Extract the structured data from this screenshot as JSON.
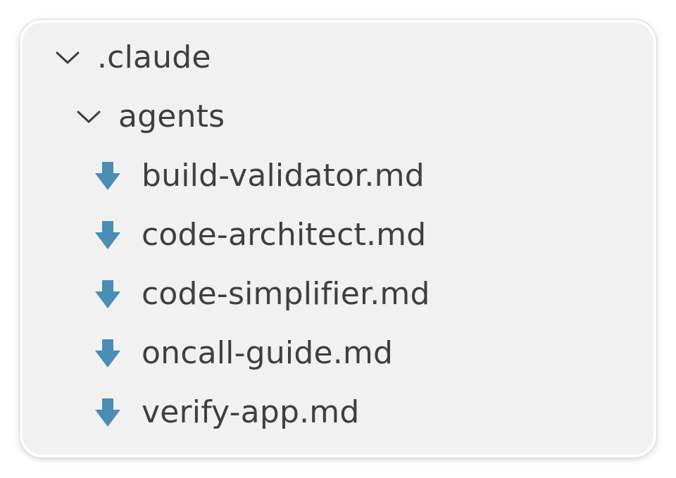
{
  "tree": {
    "root": {
      "label": ".claude",
      "expanded": true,
      "icon": "chevron-down-icon"
    },
    "folder": {
      "label": "agents",
      "expanded": true,
      "icon": "chevron-down-icon"
    },
    "files": [
      {
        "label": "build-validator.md",
        "icon": "markdown-file-icon"
      },
      {
        "label": "code-architect.md",
        "icon": "markdown-file-icon"
      },
      {
        "label": "code-simplifier.md",
        "icon": "markdown-file-icon"
      },
      {
        "label": "oncall-guide.md",
        "icon": "markdown-file-icon"
      },
      {
        "label": "verify-app.md",
        "icon": "markdown-file-icon"
      }
    ]
  },
  "colors": {
    "panel_background": "#f1f1f1",
    "text": "#3f3f3f",
    "chevron": "#3f3f3f",
    "markdown_icon": "#4a8db5"
  }
}
